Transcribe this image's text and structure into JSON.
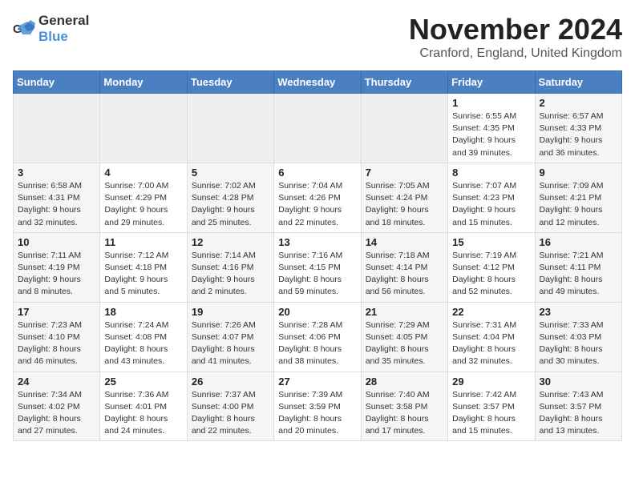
{
  "header": {
    "logo_general": "General",
    "logo_blue": "Blue",
    "title": "November 2024",
    "subtitle": "Cranford, England, United Kingdom"
  },
  "columns": [
    "Sunday",
    "Monday",
    "Tuesday",
    "Wednesday",
    "Thursday",
    "Friday",
    "Saturday"
  ],
  "weeks": [
    [
      {
        "day": "",
        "info": ""
      },
      {
        "day": "",
        "info": ""
      },
      {
        "day": "",
        "info": ""
      },
      {
        "day": "",
        "info": ""
      },
      {
        "day": "",
        "info": ""
      },
      {
        "day": "1",
        "info": "Sunrise: 6:55 AM\nSunset: 4:35 PM\nDaylight: 9 hours\nand 39 minutes."
      },
      {
        "day": "2",
        "info": "Sunrise: 6:57 AM\nSunset: 4:33 PM\nDaylight: 9 hours\nand 36 minutes."
      }
    ],
    [
      {
        "day": "3",
        "info": "Sunrise: 6:58 AM\nSunset: 4:31 PM\nDaylight: 9 hours\nand 32 minutes."
      },
      {
        "day": "4",
        "info": "Sunrise: 7:00 AM\nSunset: 4:29 PM\nDaylight: 9 hours\nand 29 minutes."
      },
      {
        "day": "5",
        "info": "Sunrise: 7:02 AM\nSunset: 4:28 PM\nDaylight: 9 hours\nand 25 minutes."
      },
      {
        "day": "6",
        "info": "Sunrise: 7:04 AM\nSunset: 4:26 PM\nDaylight: 9 hours\nand 22 minutes."
      },
      {
        "day": "7",
        "info": "Sunrise: 7:05 AM\nSunset: 4:24 PM\nDaylight: 9 hours\nand 18 minutes."
      },
      {
        "day": "8",
        "info": "Sunrise: 7:07 AM\nSunset: 4:23 PM\nDaylight: 9 hours\nand 15 minutes."
      },
      {
        "day": "9",
        "info": "Sunrise: 7:09 AM\nSunset: 4:21 PM\nDaylight: 9 hours\nand 12 minutes."
      }
    ],
    [
      {
        "day": "10",
        "info": "Sunrise: 7:11 AM\nSunset: 4:19 PM\nDaylight: 9 hours\nand 8 minutes."
      },
      {
        "day": "11",
        "info": "Sunrise: 7:12 AM\nSunset: 4:18 PM\nDaylight: 9 hours\nand 5 minutes."
      },
      {
        "day": "12",
        "info": "Sunrise: 7:14 AM\nSunset: 4:16 PM\nDaylight: 9 hours\nand 2 minutes."
      },
      {
        "day": "13",
        "info": "Sunrise: 7:16 AM\nSunset: 4:15 PM\nDaylight: 8 hours\nand 59 minutes."
      },
      {
        "day": "14",
        "info": "Sunrise: 7:18 AM\nSunset: 4:14 PM\nDaylight: 8 hours\nand 56 minutes."
      },
      {
        "day": "15",
        "info": "Sunrise: 7:19 AM\nSunset: 4:12 PM\nDaylight: 8 hours\nand 52 minutes."
      },
      {
        "day": "16",
        "info": "Sunrise: 7:21 AM\nSunset: 4:11 PM\nDaylight: 8 hours\nand 49 minutes."
      }
    ],
    [
      {
        "day": "17",
        "info": "Sunrise: 7:23 AM\nSunset: 4:10 PM\nDaylight: 8 hours\nand 46 minutes."
      },
      {
        "day": "18",
        "info": "Sunrise: 7:24 AM\nSunset: 4:08 PM\nDaylight: 8 hours\nand 43 minutes."
      },
      {
        "day": "19",
        "info": "Sunrise: 7:26 AM\nSunset: 4:07 PM\nDaylight: 8 hours\nand 41 minutes."
      },
      {
        "day": "20",
        "info": "Sunrise: 7:28 AM\nSunset: 4:06 PM\nDaylight: 8 hours\nand 38 minutes."
      },
      {
        "day": "21",
        "info": "Sunrise: 7:29 AM\nSunset: 4:05 PM\nDaylight: 8 hours\nand 35 minutes."
      },
      {
        "day": "22",
        "info": "Sunrise: 7:31 AM\nSunset: 4:04 PM\nDaylight: 8 hours\nand 32 minutes."
      },
      {
        "day": "23",
        "info": "Sunrise: 7:33 AM\nSunset: 4:03 PM\nDaylight: 8 hours\nand 30 minutes."
      }
    ],
    [
      {
        "day": "24",
        "info": "Sunrise: 7:34 AM\nSunset: 4:02 PM\nDaylight: 8 hours\nand 27 minutes."
      },
      {
        "day": "25",
        "info": "Sunrise: 7:36 AM\nSunset: 4:01 PM\nDaylight: 8 hours\nand 24 minutes."
      },
      {
        "day": "26",
        "info": "Sunrise: 7:37 AM\nSunset: 4:00 PM\nDaylight: 8 hours\nand 22 minutes."
      },
      {
        "day": "27",
        "info": "Sunrise: 7:39 AM\nSunset: 3:59 PM\nDaylight: 8 hours\nand 20 minutes."
      },
      {
        "day": "28",
        "info": "Sunrise: 7:40 AM\nSunset: 3:58 PM\nDaylight: 8 hours\nand 17 minutes."
      },
      {
        "day": "29",
        "info": "Sunrise: 7:42 AM\nSunset: 3:57 PM\nDaylight: 8 hours\nand 15 minutes."
      },
      {
        "day": "30",
        "info": "Sunrise: 7:43 AM\nSunset: 3:57 PM\nDaylight: 8 hours\nand 13 minutes."
      }
    ]
  ]
}
